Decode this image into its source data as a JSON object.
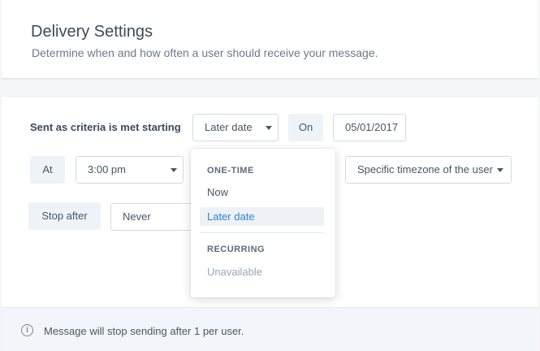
{
  "header": {
    "title": "Delivery Settings",
    "subtitle": "Determine when and how often a user should receive your message."
  },
  "schedule": {
    "criteria_label": "Sent as criteria is met starting",
    "start_select_value": "Later date",
    "on_label": "On",
    "date_value": "05/01/2017",
    "at_label": "At",
    "time_select_value": "3:00 pm",
    "timezone_select_value": "Specific timezone of the user",
    "stop_after_label": "Stop after",
    "stop_select_value": "Never"
  },
  "dropdown": {
    "section_one_time": "ONE-TIME",
    "items_one_time": [
      "Now",
      "Later date"
    ],
    "selected_item": "Later date",
    "section_recurring": "RECURRING",
    "items_recurring": [
      "Unavailable"
    ]
  },
  "footer": {
    "info_icon": "i",
    "message": "Message will stop sending after 1 per user."
  },
  "colors": {
    "accent": "#2f7fd6",
    "pill_bg": "#eef3f8",
    "footer_bg": "#f2f6fa"
  }
}
